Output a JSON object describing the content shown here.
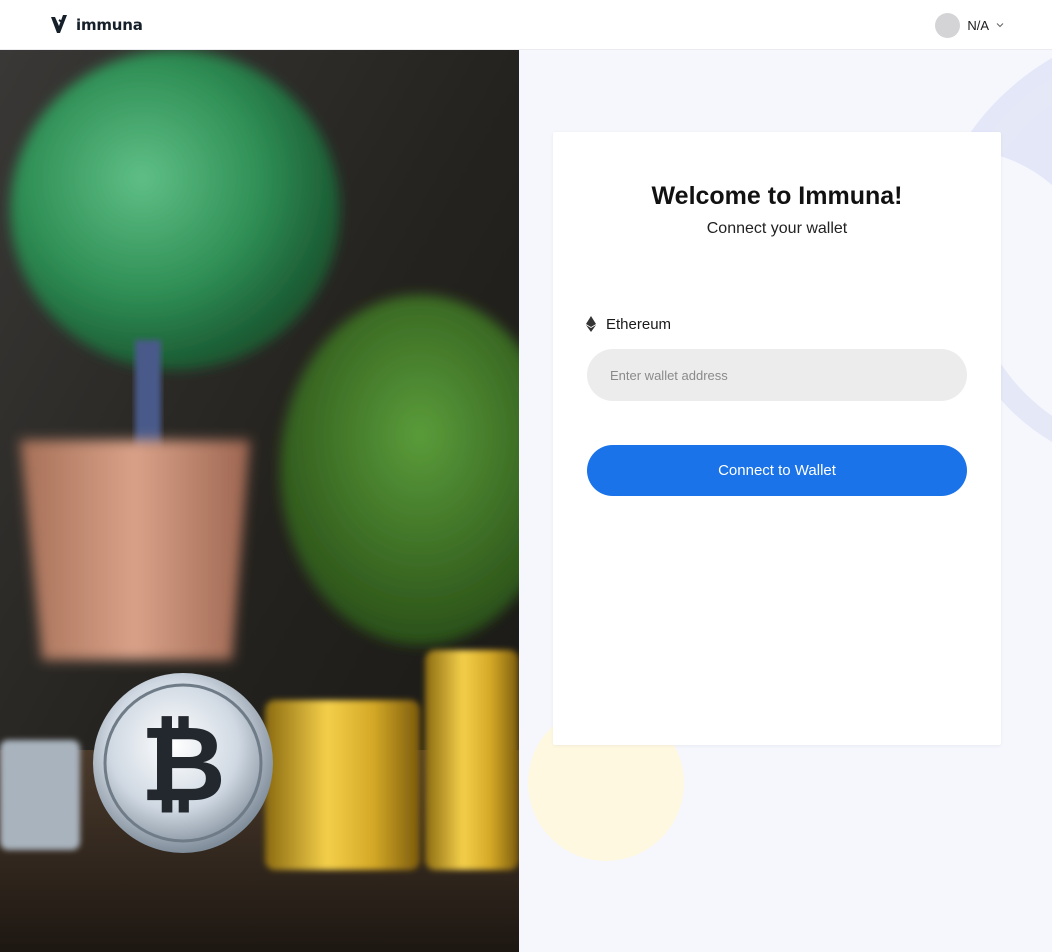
{
  "header": {
    "brand_name": "immuna",
    "user_name": "N/A"
  },
  "login": {
    "title": "Welcome to Immuna!",
    "subtitle": "Connect your wallet",
    "network_label": "Ethereum",
    "wallet_placeholder": "Enter wallet address",
    "connect_label": "Connect to Wallet"
  },
  "colors": {
    "primary": "#1a73e8",
    "input_bg": "#ececec",
    "page_bg": "#f5f7fd",
    "accent_yellow": "#fff8e1"
  },
  "icons": {
    "logo": "immuna-logo-icon",
    "network": "ethereum-icon",
    "menu": "chevron-down-icon"
  }
}
